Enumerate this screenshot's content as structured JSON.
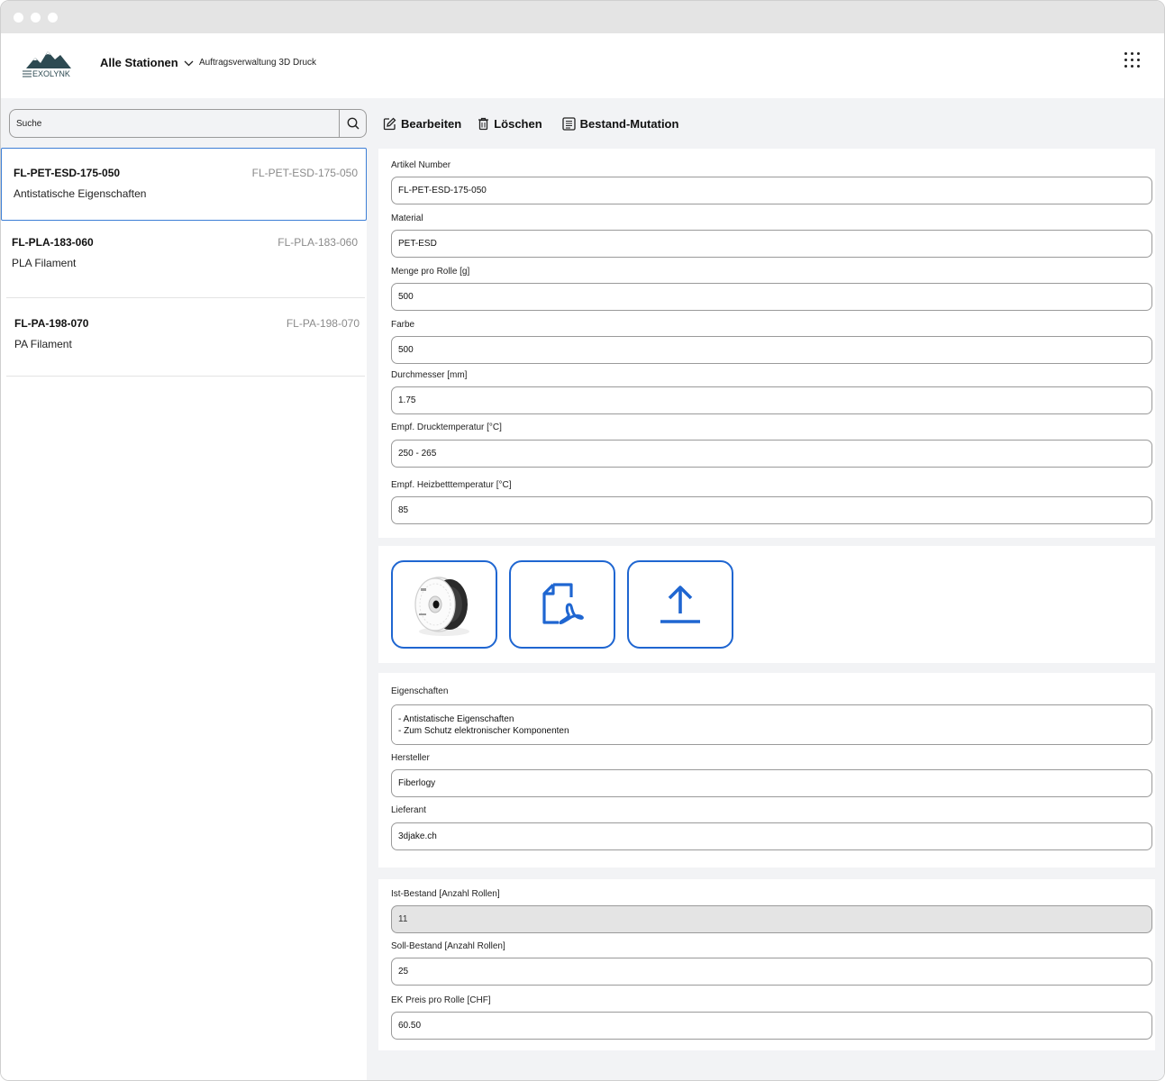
{
  "app": {
    "brand": "EXOLYNK",
    "station_selector": "Alle Stationen",
    "subtitle": "Auftragsverwaltung 3D Druck"
  },
  "search": {
    "placeholder": "Suche"
  },
  "list": [
    {
      "code": "FL-PET-ESD-175-050",
      "code_secondary": "FL-PET-ESD-175-050",
      "description": "Antistatische Eigenschaften",
      "selected": true
    },
    {
      "code": "FL-PLA-183-060",
      "code_secondary": "FL-PLA-183-060",
      "description": "PLA Filament",
      "selected": false
    },
    {
      "code": "FL-PA-198-070",
      "code_secondary": "FL-PA-198-070",
      "description": "PA Filament",
      "selected": false
    }
  ],
  "toolbar": {
    "edit_label": "Bearbeiten",
    "delete_label": "Löschen",
    "stock_label": "Bestand-Mutation"
  },
  "details": {
    "artikel_number": {
      "label": "Artikel Number",
      "value": "FL-PET-ESD-175-050"
    },
    "material": {
      "label": "Material",
      "value": "PET-ESD"
    },
    "menge": {
      "label": "Menge pro Rolle [g]",
      "value": "500"
    },
    "farbe": {
      "label": "Farbe",
      "value": "500"
    },
    "durchmesser": {
      "label": "Durchmesser [mm]",
      "value": "1.75"
    },
    "drucktemp": {
      "label": "Empf. Drucktemperatur [°C]",
      "value": "250 - 265"
    },
    "heizbett": {
      "label": "Empf. Heizbetttemperatur [°C]",
      "value": "85"
    }
  },
  "media": {
    "image_icon": "filament-spool-image",
    "pdf_icon": "pdf-document-icon",
    "upload_icon": "upload-icon"
  },
  "properties": {
    "eigenschaften": {
      "label": "Eigenschaften",
      "value": "- Antistatische Eigenschaften\n- Zum Schutz elektronischer Komponenten"
    },
    "hersteller": {
      "label": "Hersteller",
      "value": "Fiberlogy"
    },
    "lieferant": {
      "label": "Lieferant",
      "value": "3djake.ch"
    }
  },
  "stock": {
    "ist": {
      "label": "Ist-Bestand [Anzahl Rollen]",
      "value": "11"
    },
    "soll": {
      "label": "Soll-Bestand [Anzahl Rollen]",
      "value": "25"
    },
    "preis": {
      "label": "EK Preis pro Rolle [CHF]",
      "value": "60.50"
    }
  },
  "colors": {
    "accent": "#1f66d1",
    "selection_border": "#3d7fd6",
    "panel_bg": "#f2f3f5",
    "readonly_bg": "#e4e4e4"
  }
}
